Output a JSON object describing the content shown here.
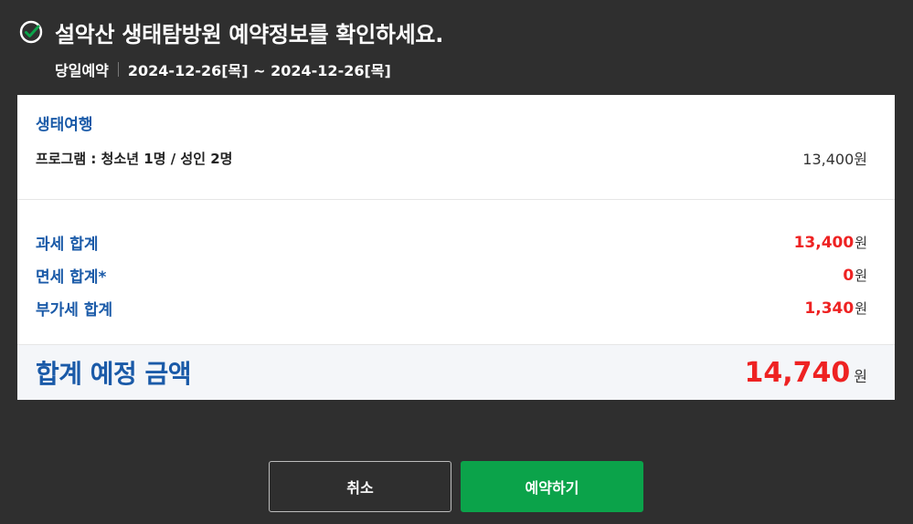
{
  "header": {
    "title": "설악산 생태탐방원 예약정보를 확인하세요.",
    "reservation_type": "당일예약",
    "date_range": "2024-12-26[목] ~ 2024-12-26[목]",
    "icon": "check-circle-icon"
  },
  "program": {
    "section_title": "생태여행",
    "label": "프로그램 : 청소년 1명 / 성인 2명",
    "price": "13,400원"
  },
  "totals": [
    {
      "label": "과세 합계",
      "amount": "13,400",
      "unit": "원"
    },
    {
      "label": "면세 합계*",
      "amount": "0",
      "unit": "원"
    },
    {
      "label": "부가세 합계",
      "amount": "1,340",
      "unit": "원"
    }
  ],
  "grand_total": {
    "label": "합계 예정 금액",
    "amount": "14,740",
    "unit": "원"
  },
  "buttons": {
    "cancel": "취소",
    "reserve": "예약하기"
  },
  "colors": {
    "background": "#2f2f2f",
    "accent_blue": "#1a5aa8",
    "amount_red": "#ee2222",
    "reserve_green": "#0ba34a"
  }
}
